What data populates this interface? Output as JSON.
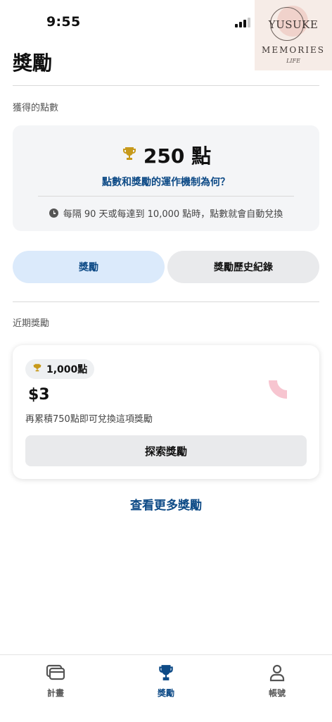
{
  "status_bar": {
    "time": "9:55"
  },
  "watermark": {
    "line1": "YUSUKE",
    "line2": "MEMORIES",
    "line3": "LIFE"
  },
  "page": {
    "title": "獎勵"
  },
  "points_section": {
    "label": "獲得的點數",
    "points": "250 點",
    "how_link": "點數和獎勵的運作機制為何？",
    "exchange_note": "每隔 90 天或每達到 10,000 點時，點數就會自動兌換"
  },
  "tabs": [
    {
      "label": "獎勵",
      "active": true
    },
    {
      "label": "獎勵歷史紀錄",
      "active": false
    }
  ],
  "recent_section": {
    "label": "近期獎勵"
  },
  "reward_card": {
    "points_badge": "1,000點",
    "amount": "$3",
    "note": "再累積750點即可兌換這項獎勵",
    "button": "探索獎勵",
    "progress_fraction": 0.25,
    "progress_color": "#f7c5d0"
  },
  "see_more": "查看更多獎勵",
  "bottom_nav": [
    {
      "label": "計畫",
      "icon": "card-icon"
    },
    {
      "label": "獎勵",
      "icon": "trophy-icon",
      "active": true
    },
    {
      "label": "帳號",
      "icon": "person-icon"
    }
  ],
  "colors": {
    "accent": "#0d4a86",
    "trophy": "#c79a1c",
    "tab_active_bg": "#dbeafb"
  }
}
